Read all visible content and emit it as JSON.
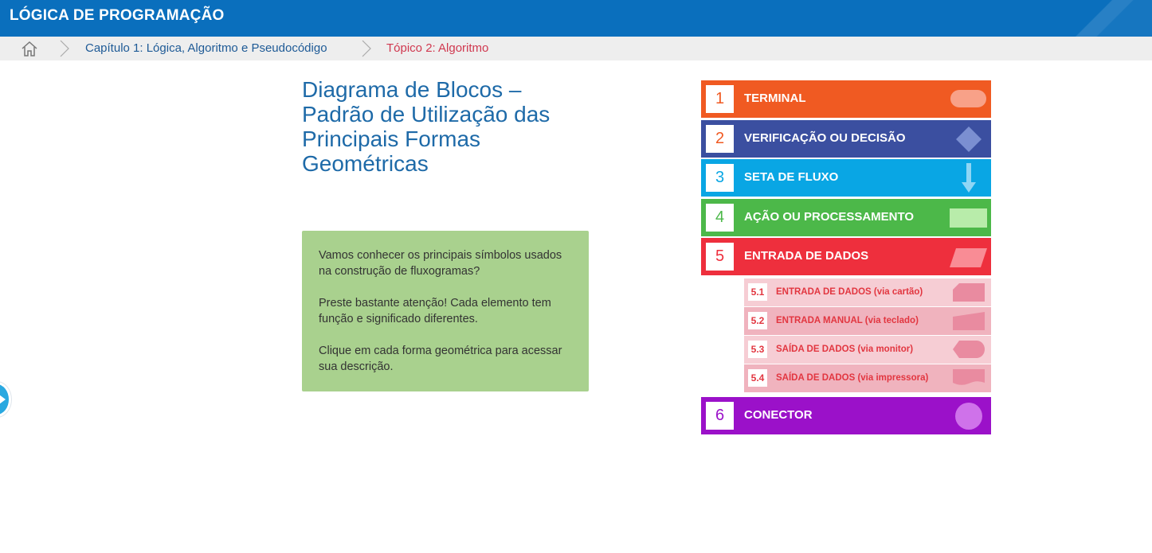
{
  "header": {
    "title": "LÓGICA DE PROGRAMAÇÃO",
    "color": "#0a6fbd"
  },
  "breadcrumb": {
    "home_icon": "home-icon",
    "items": [
      {
        "label": "Capítulo 1: Lógica, Algoritmo e Pseudocódigo"
      },
      {
        "label": "Tópico 2: Algoritmo"
      }
    ]
  },
  "main": {
    "title": "Diagrama de Blocos – Padrão de Utilização das Principais Formas Geométricas",
    "intro_paragraphs": [
      "Vamos conhecer os principais símbolos usados na construção de fluxogramas?",
      "Preste bastante atenção! Cada elemento tem função e significado diferentes.",
      "Clique em cada forma geométrica para acessar sua descrição."
    ]
  },
  "shapes": [
    {
      "number": "1",
      "label": "TERMINAL",
      "color": "#f05a22",
      "icon": "terminal-shape-icon"
    },
    {
      "number": "2",
      "label": "VERIFICAÇÃO OU DECISÃO",
      "color": "#3b4fa0",
      "icon": "decision-diamond-icon"
    },
    {
      "number": "3",
      "label": "SETA DE FLUXO",
      "color": "#09a6e4",
      "icon": "arrow-down-icon"
    },
    {
      "number": "4",
      "label": "AÇÃO OU PROCESSAMENTO",
      "color": "#4cb849",
      "icon": "process-rectangle-icon"
    },
    {
      "number": "5",
      "label": "ENTRADA DE DADOS",
      "color": "#ee2f3d",
      "icon": "parallelogram-icon"
    },
    {
      "number": "6",
      "label": "CONECTOR",
      "color": "#9b11c9",
      "icon": "connector-circle-icon"
    }
  ],
  "sub_shapes": [
    {
      "number": "5.1",
      "label": "ENTRADA DE DADOS (via cartão)",
      "bg": "#f6cdd4",
      "icon": "card-shape-icon"
    },
    {
      "number": "5.2",
      "label": "ENTRADA MANUAL (via teclado)",
      "bg": "#f0b3be",
      "icon": "manual-input-icon"
    },
    {
      "number": "5.3",
      "label": "SAÍDA DE DADOS (via monitor)",
      "bg": "#f6cdd4",
      "icon": "display-shape-icon"
    },
    {
      "number": "5.4",
      "label": "SAÍDA DE DADOS (via impressora)",
      "bg": "#f0b3be",
      "icon": "document-shape-icon"
    }
  ],
  "side_nav": {
    "icon": "next-arrow-icon"
  }
}
